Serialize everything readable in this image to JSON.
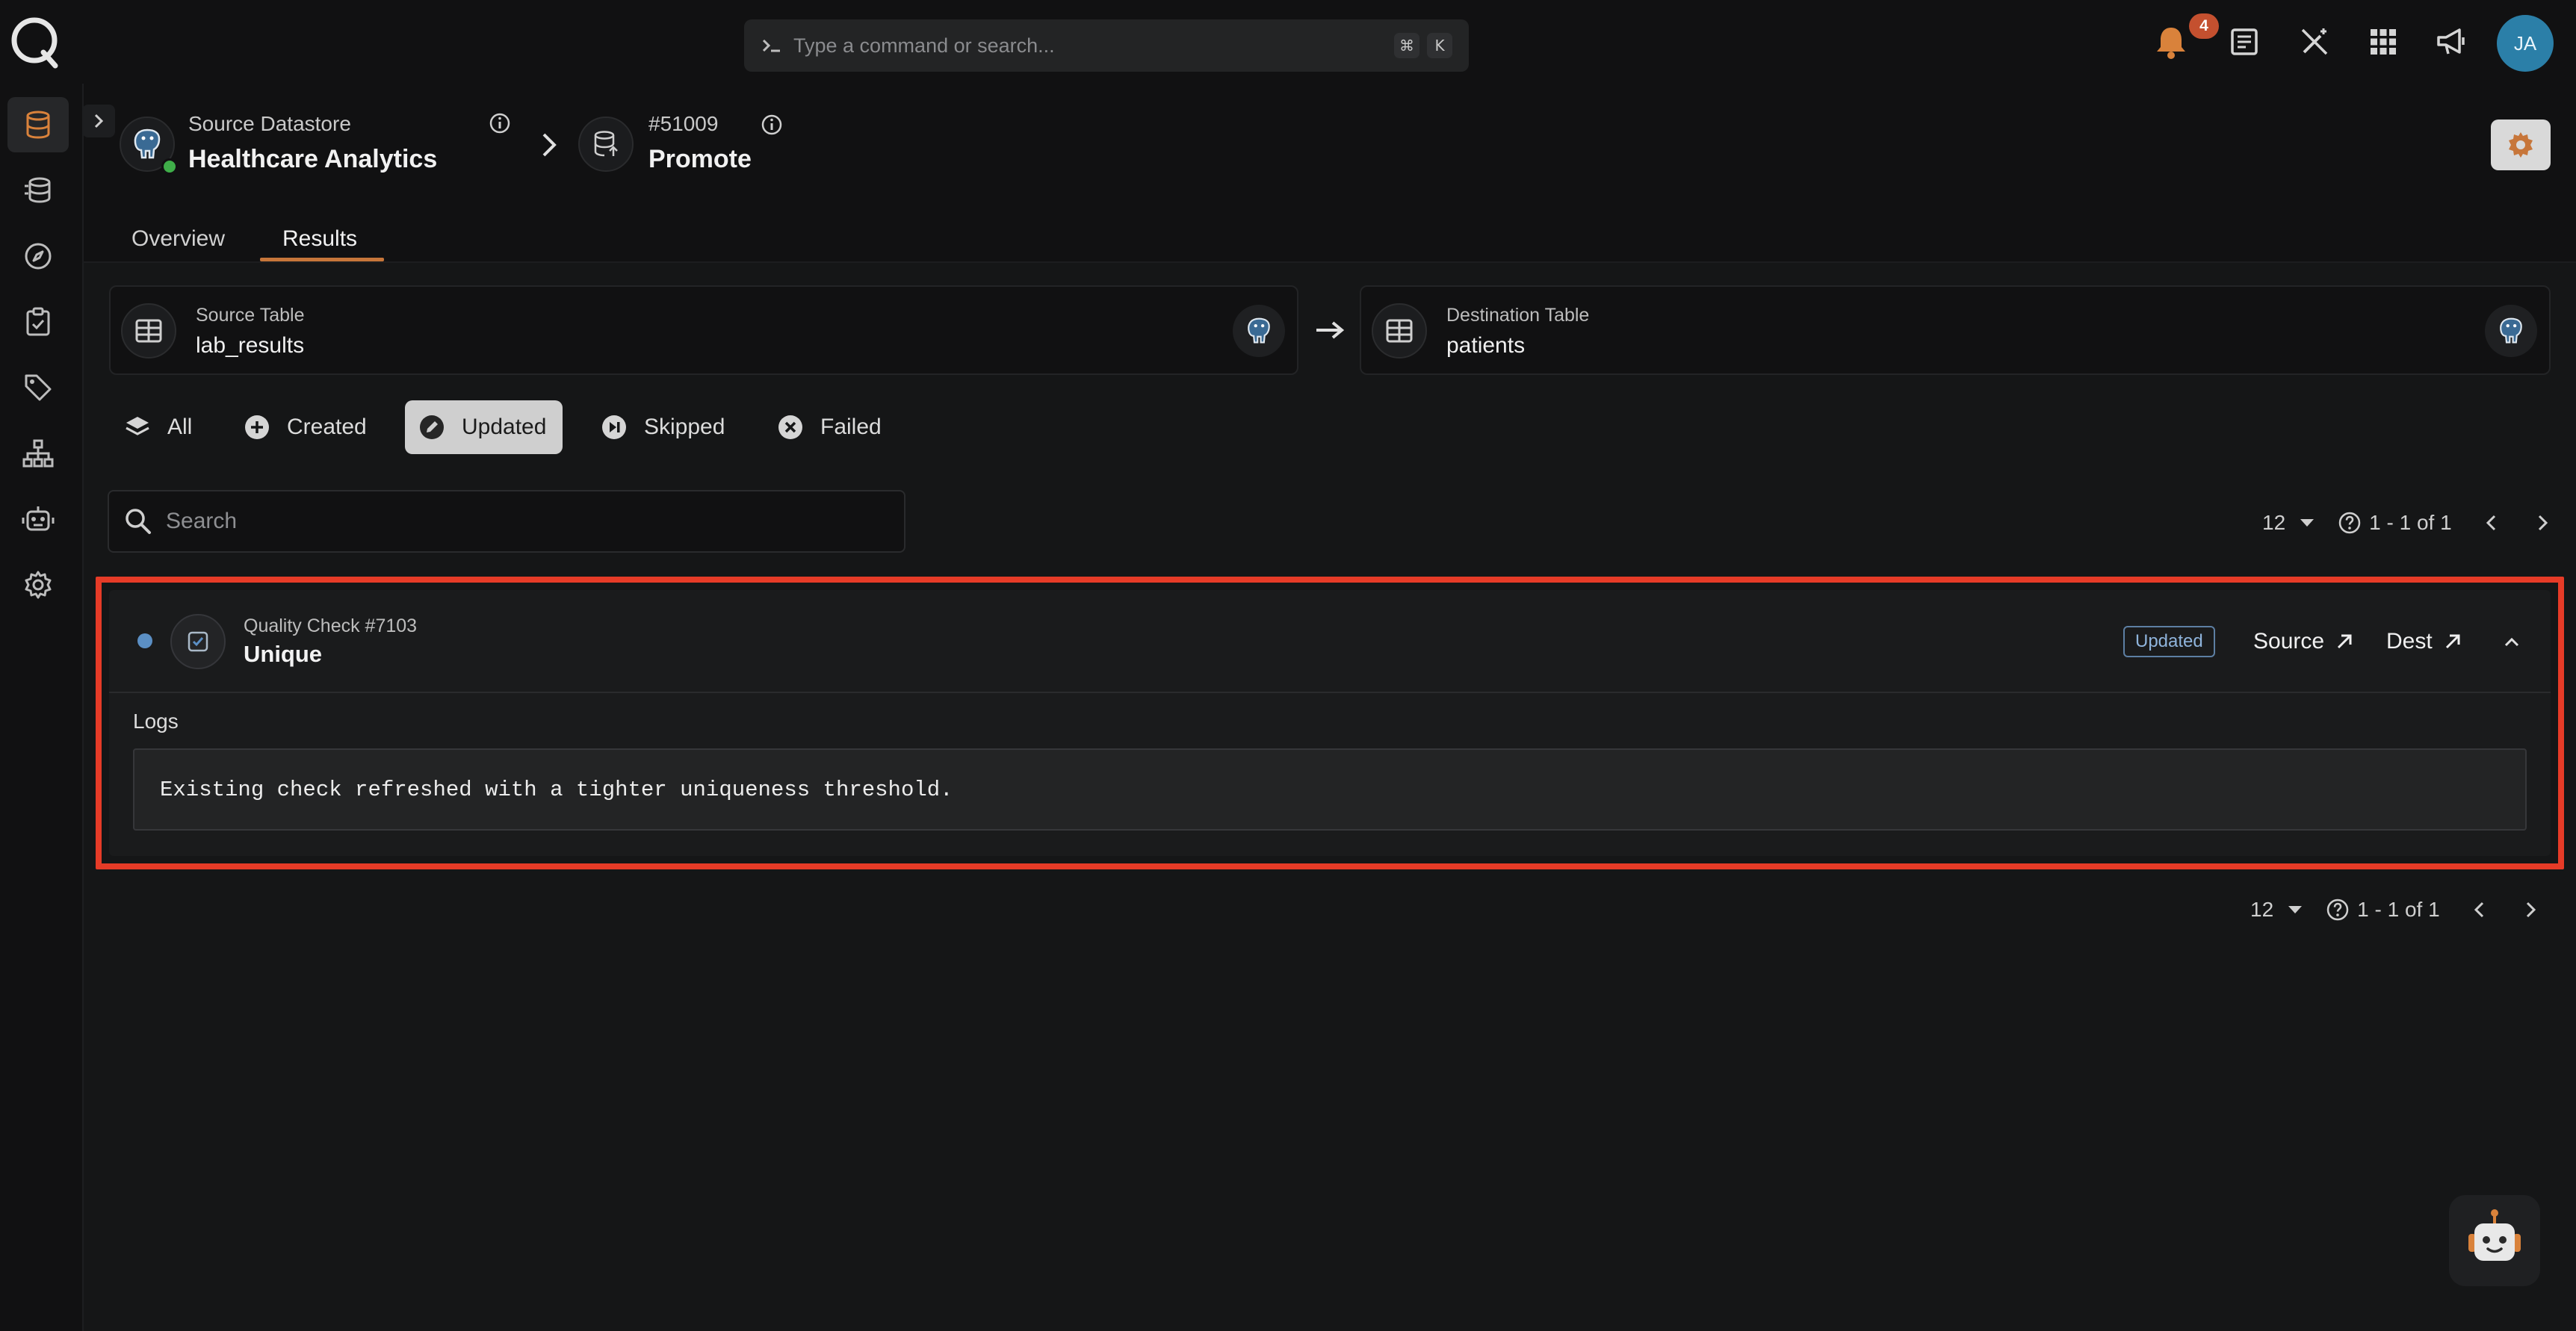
{
  "topbar": {
    "command_placeholder": "Type a command or search...",
    "shortcut_keys": [
      "⌘",
      "K"
    ],
    "notification_count": "4",
    "user_initials": "JA"
  },
  "sidebar": {
    "items": [
      {
        "icon": "database-icon",
        "active": true
      },
      {
        "icon": "stacked-database-icon",
        "active": false
      },
      {
        "icon": "compass-icon",
        "active": false
      },
      {
        "icon": "clipboard-check-icon",
        "active": false
      },
      {
        "icon": "tag-icon",
        "active": false
      },
      {
        "icon": "hierarchy-icon",
        "active": false
      },
      {
        "icon": "robot-icon",
        "active": false
      },
      {
        "icon": "gear-icon",
        "active": false
      }
    ]
  },
  "header": {
    "datastore_label": "Source Datastore",
    "datastore_name": "Healthcare Analytics",
    "operation_id": "#51009",
    "operation_name": "Promote"
  },
  "tabs": [
    {
      "label": "Overview",
      "active": false
    },
    {
      "label": "Results",
      "active": true
    }
  ],
  "source_table": {
    "label": "Source Table",
    "name": "lab_results"
  },
  "destination_table": {
    "label": "Destination Table",
    "name": "patients"
  },
  "filters": [
    {
      "label": "All",
      "icon": "layers-icon",
      "active": false
    },
    {
      "label": "Created",
      "icon": "plus-circle-icon",
      "active": false
    },
    {
      "label": "Updated",
      "icon": "pencil-circle-icon",
      "active": true
    },
    {
      "label": "Skipped",
      "icon": "skip-circle-icon",
      "active": false
    },
    {
      "label": "Failed",
      "icon": "x-circle-icon",
      "active": false
    }
  ],
  "search": {
    "placeholder": "Search"
  },
  "pagination": {
    "page_size": "12",
    "range": "1 - 1 of 1"
  },
  "result": {
    "check_label": "Quality Check #7103",
    "check_name": "Unique",
    "status": "Updated",
    "source_link": "Source",
    "dest_link": "Dest",
    "logs_label": "Logs",
    "log_text": "Existing check refreshed with a tighter uniqueness threshold."
  },
  "colors": {
    "accent": "#c7763a",
    "highlight_border": "#e63b27",
    "status_dot": "#5b8fc4",
    "badge": "#8fb4dc",
    "avatar_bg": "#2b7fa8"
  }
}
